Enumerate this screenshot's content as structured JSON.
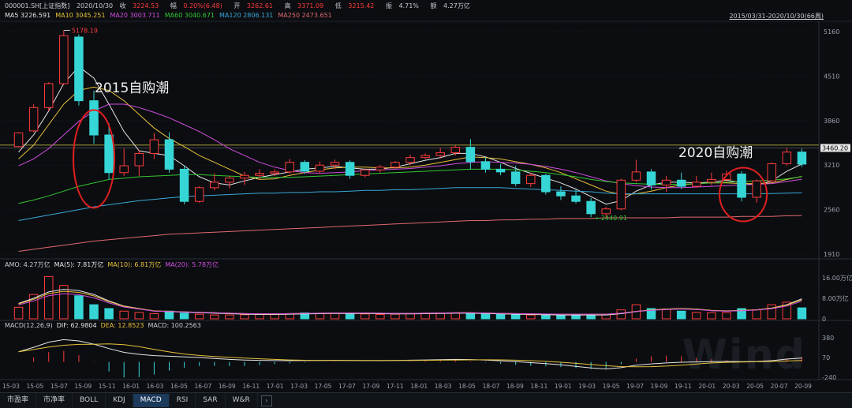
{
  "header": {
    "symbol": "000001.SH[上证指数]",
    "date": "2020/10/30",
    "close_label": "收",
    "close": "3224.53",
    "change_label": "幅",
    "change": "0.20%(6.48)",
    "open_label": "开",
    "open": "3262.61",
    "high_label": "高",
    "high": "3371.09",
    "low_label": "低",
    "low": "3215.42",
    "amplitude_label": "振",
    "amplitude": "4.71%",
    "volume_label": "额",
    "volume": "4.27万亿",
    "range": "2015/03/31-2020/10/30(66周)"
  },
  "colors": {
    "up": "#ff3b3b",
    "down": "#37d6d6",
    "ma5": "#e6e6e6",
    "ma10": "#e8c13a",
    "ma20": "#d24de0",
    "ma60": "#33c833",
    "ma120": "#3aa8d8",
    "ma250": "#e0696f",
    "annotation": "#e02020",
    "price_line": "#d7d24a"
  },
  "ma_bar": [
    {
      "label": "MA5",
      "value": "3226.591",
      "color": "#e6e6e6"
    },
    {
      "label": "MA10",
      "value": "3045.251",
      "color": "#e8c13a"
    },
    {
      "label": "MA20",
      "value": "3003.711",
      "color": "#d24de0"
    },
    {
      "label": "MA60",
      "value": "3040.671",
      "color": "#33c833"
    },
    {
      "label": "MA120",
      "value": "2806.131",
      "color": "#3aa8d8"
    },
    {
      "label": "MA250",
      "value": "2473.651",
      "color": "#e0696f"
    }
  ],
  "price_axis": [
    "5160",
    "4510",
    "3860",
    "3210",
    "2560",
    "1910"
  ],
  "price_markers": {
    "current": "3460.20",
    "upper": "3502.00"
  },
  "annotations": {
    "high_label": "5178.19",
    "low_label": "2440.91",
    "note_2015": "2015自购潮",
    "note_2020": "2020自购潮"
  },
  "amo_bar": [
    {
      "label": "AMO: 4.27万亿",
      "color": "#c8ccd2"
    },
    {
      "label": "MA(5): 7.81万亿",
      "color": "#e6e6e6"
    },
    {
      "label": "MA(10): 6.81万亿",
      "color": "#e8c13a"
    },
    {
      "label": "MA(20): 5.78万亿",
      "color": "#d24de0"
    }
  ],
  "amo_axis": [
    "16.00万亿",
    "8.00万亿",
    "0"
  ],
  "macd_bar": [
    {
      "label": "MACD(12,26,9)",
      "color": "#c8ccd2"
    },
    {
      "label": "DIF: 62.9804",
      "color": "#e6e6e6"
    },
    {
      "label": "DEA: 12.8523",
      "color": "#e8c13a"
    },
    {
      "label": "MACD: 100.2563",
      "color": "#c8ccd2"
    }
  ],
  "macd_axis": [
    "380",
    "70",
    "-240"
  ],
  "date_axis": [
    "15-03",
    "15-05",
    "15-07",
    "15-09",
    "15-11",
    "16-01",
    "16-03",
    "16-05",
    "16-07",
    "16-09",
    "16-11",
    "17-01",
    "17-03",
    "17-05",
    "17-07",
    "17-09",
    "17-11",
    "18-01",
    "18-03",
    "18-05",
    "18-07",
    "18-09",
    "18-11",
    "19-01",
    "19-03",
    "19-05",
    "19-07",
    "19-09",
    "19-11",
    "20-01",
    "20-03",
    "20-05",
    "20-07",
    "20-09"
  ],
  "tabs": [
    {
      "label": "市盈率",
      "active": false
    },
    {
      "label": "市净率",
      "active": false
    },
    {
      "label": "BOLL",
      "active": false
    },
    {
      "label": "KDJ",
      "active": false
    },
    {
      "label": "MACD",
      "active": true
    },
    {
      "label": "RSI",
      "active": false
    },
    {
      "label": "SAR",
      "active": false
    },
    {
      "label": "W&R",
      "active": false
    }
  ],
  "tab_arrow": "chevron-right-icon",
  "watermark": "Wind",
  "chart_data": {
    "type": "candlestick",
    "period": "weekly",
    "candles": [
      [
        3480,
        3690,
        3470,
        3680
      ],
      [
        3710,
        4100,
        3690,
        4050
      ],
      [
        4050,
        4420,
        4000,
        4400
      ],
      [
        4400,
        5178,
        4380,
        5100
      ],
      [
        5080,
        5120,
        4080,
        4150
      ],
      [
        4150,
        4300,
        3520,
        3650
      ],
      [
        3650,
        3820,
        3000,
        3100
      ],
      [
        3100,
        3450,
        3050,
        3200
      ],
      [
        3200,
        3430,
        3050,
        3380
      ],
      [
        3380,
        3680,
        3300,
        3580
      ],
      [
        3580,
        3690,
        3100,
        3150
      ],
      [
        3150,
        3200,
        2638,
        2680
      ],
      [
        2680,
        2900,
        2660,
        2880
      ],
      [
        2880,
        3090,
        2840,
        2960
      ],
      [
        2960,
        3050,
        2870,
        3020
      ],
      [
        3020,
        3110,
        2920,
        3060
      ],
      [
        3060,
        3150,
        3000,
        3090
      ],
      [
        3090,
        3150,
        3050,
        3110
      ],
      [
        3110,
        3300,
        3080,
        3250
      ],
      [
        3250,
        3280,
        3080,
        3120
      ],
      [
        3120,
        3260,
        3090,
        3210
      ],
      [
        3210,
        3290,
        3150,
        3250
      ],
      [
        3250,
        3280,
        3010,
        3060
      ],
      [
        3060,
        3150,
        3030,
        3140
      ],
      [
        3140,
        3210,
        3100,
        3180
      ],
      [
        3180,
        3270,
        3160,
        3250
      ],
      [
        3250,
        3360,
        3210,
        3320
      ],
      [
        3320,
        3380,
        3300,
        3350
      ],
      [
        3350,
        3460,
        3320,
        3390
      ],
      [
        3390,
        3500,
        3350,
        3470
      ],
      [
        3470,
        3590,
        3150,
        3260
      ],
      [
        3260,
        3320,
        3100,
        3150
      ],
      [
        3150,
        3230,
        3060,
        3110
      ],
      [
        3110,
        3200,
        2900,
        2940
      ],
      [
        2940,
        3100,
        2890,
        3060
      ],
      [
        3060,
        3080,
        2780,
        2820
      ],
      [
        2820,
        2900,
        2700,
        2760
      ],
      [
        2760,
        2850,
        2650,
        2680
      ],
      [
        2680,
        2730,
        2449,
        2500
      ],
      [
        2500,
        2600,
        2440,
        2570
      ],
      [
        2570,
        3010,
        2550,
        2990
      ],
      [
        2990,
        3288,
        2960,
        3110
      ],
      [
        3110,
        3150,
        2850,
        2920
      ],
      [
        2920,
        3050,
        2820,
        2990
      ],
      [
        2990,
        3100,
        2860,
        2900
      ],
      [
        2900,
        3050,
        2880,
        2960
      ],
      [
        2960,
        3100,
        2920,
        3000
      ],
      [
        3000,
        3130,
        2960,
        3080
      ],
      [
        3080,
        3120,
        2680,
        2740
      ],
      [
        2740,
        3000,
        2660,
        2980
      ],
      [
        2980,
        3250,
        2960,
        3230
      ],
      [
        3230,
        3460,
        3200,
        3400
      ],
      [
        3400,
        3450,
        3180,
        3224
      ]
    ],
    "ma_series": [
      {
        "name": "MA5",
        "values": [
          3400,
          3650,
          4000,
          4400,
          4650,
          4480,
          4100,
          3700,
          3420,
          3380,
          3350,
          3200,
          3040,
          2950,
          2920,
          2980,
          3030,
          3070,
          3110,
          3150,
          3170,
          3190,
          3170,
          3150,
          3150,
          3180,
          3230,
          3280,
          3320,
          3380,
          3380,
          3330,
          3250,
          3160,
          3090,
          3020,
          2950,
          2860,
          2750,
          2640,
          2690,
          2830,
          2920,
          2960,
          2960,
          2950,
          2960,
          2990,
          2950,
          2920,
          2980,
          3120,
          3226.59
        ]
      },
      {
        "name": "MA10",
        "values": [
          3300,
          3500,
          3800,
          4100,
          4300,
          4350,
          4300,
          4150,
          3950,
          3750,
          3600,
          3480,
          3350,
          3250,
          3150,
          3050,
          3000,
          3010,
          3060,
          3100,
          3140,
          3170,
          3180,
          3180,
          3170,
          3170,
          3180,
          3210,
          3250,
          3290,
          3330,
          3320,
          3300,
          3260,
          3220,
          3170,
          3100,
          3010,
          2920,
          2830,
          2780,
          2790,
          2830,
          2880,
          2920,
          2940,
          2950,
          2950,
          2940,
          2940,
          2950,
          3000,
          3045.25
        ]
      },
      {
        "name": "MA20",
        "values": [
          3200,
          3300,
          3450,
          3650,
          3850,
          4000,
          4100,
          4100,
          4050,
          3980,
          3900,
          3800,
          3700,
          3580,
          3450,
          3350,
          3250,
          3180,
          3130,
          3100,
          3090,
          3100,
          3110,
          3130,
          3140,
          3150,
          3160,
          3180,
          3200,
          3230,
          3250,
          3260,
          3250,
          3240,
          3220,
          3190,
          3150,
          3100,
          3040,
          2980,
          2940,
          2910,
          2890,
          2880,
          2880,
          2890,
          2900,
          2910,
          2920,
          2930,
          2940,
          2970,
          3003.71
        ]
      },
      {
        "name": "MA60",
        "values": [
          2650,
          2700,
          2760,
          2830,
          2900,
          2950,
          3000,
          3020,
          3040,
          3050,
          3060,
          3070,
          3070,
          3060,
          3050,
          3040,
          3030,
          3030,
          3030,
          3040,
          3050,
          3060,
          3070,
          3080,
          3090,
          3100,
          3110,
          3120,
          3130,
          3140,
          3150,
          3150,
          3150,
          3140,
          3120,
          3100,
          3070,
          3040,
          3000,
          2970,
          2950,
          2940,
          2930,
          2930,
          2930,
          2940,
          2950,
          2960,
          2970,
          2980,
          2990,
          3010,
          3040.67
        ]
      },
      {
        "name": "MA120",
        "values": [
          2400,
          2440,
          2480,
          2520,
          2560,
          2600,
          2630,
          2660,
          2690,
          2710,
          2730,
          2750,
          2760,
          2770,
          2780,
          2790,
          2800,
          2800,
          2810,
          2810,
          2820,
          2820,
          2830,
          2840,
          2840,
          2850,
          2850,
          2860,
          2870,
          2880,
          2880,
          2880,
          2880,
          2870,
          2860,
          2850,
          2840,
          2830,
          2820,
          2800,
          2790,
          2790,
          2790,
          2790,
          2790,
          2790,
          2790,
          2790,
          2790,
          2790,
          2795,
          2800,
          2806.13
        ]
      },
      {
        "name": "MA250",
        "values": [
          1950,
          1980,
          2010,
          2040,
          2070,
          2100,
          2120,
          2140,
          2160,
          2180,
          2200,
          2210,
          2220,
          2230,
          2240,
          2250,
          2260,
          2270,
          2280,
          2290,
          2300,
          2310,
          2320,
          2330,
          2340,
          2350,
          2360,
          2370,
          2380,
          2390,
          2400,
          2400,
          2410,
          2410,
          2420,
          2420,
          2430,
          2430,
          2430,
          2440,
          2440,
          2440,
          2440,
          2440,
          2450,
          2450,
          2450,
          2450,
          2460,
          2460,
          2460,
          2470,
          2473.65
        ]
      }
    ],
    "amo_values": [
      4.5,
      9.5,
      16.5,
      13.0,
      9.0,
      5.5,
      4.0,
      3.0,
      2.5,
      2.0,
      3.0,
      2.2,
      1.8,
      1.5,
      1.5,
      1.6,
      1.7,
      1.8,
      2.0,
      2.3,
      2.1,
      2.2,
      2.0,
      1.9,
      1.7,
      1.8,
      2.0,
      2.2,
      2.3,
      2.2,
      2.0,
      1.8,
      1.7,
      1.6,
      1.5,
      1.5,
      1.4,
      1.5,
      1.5,
      1.6,
      3.5,
      5.5,
      4.0,
      3.8,
      3.0,
      2.5,
      2.4,
      2.5,
      4.0,
      3.5,
      5.5,
      6.5,
      4.27
    ],
    "amo_ma5": [
      6.0,
      8.0,
      10.5,
      11.5,
      11.0,
      9.5,
      7.0,
      5.0,
      4.0,
      3.0,
      2.8,
      2.6,
      2.4,
      2.2,
      2.0,
      1.8,
      1.7,
      1.7,
      1.8,
      1.9,
      2.0,
      2.1,
      2.1,
      2.1,
      2.0,
      1.9,
      1.9,
      2.0,
      2.1,
      2.2,
      2.2,
      2.1,
      1.9,
      1.8,
      1.7,
      1.6,
      1.5,
      1.5,
      1.5,
      1.5,
      2.0,
      2.8,
      3.4,
      3.8,
      4.0,
      3.8,
      3.2,
      3.0,
      3.2,
      3.5,
      4.2,
      5.5,
      7.81
    ],
    "macd_dif": [
      160,
      230,
      310,
      350,
      330,
      280,
      210,
      150,
      120,
      100,
      90,
      80,
      70,
      55,
      40,
      30,
      25,
      22,
      20,
      22,
      24,
      26,
      24,
      22,
      22,
      24,
      28,
      32,
      36,
      40,
      38,
      30,
      18,
      5,
      -10,
      -25,
      -45,
      -70,
      -95,
      -110,
      -90,
      -50,
      -30,
      -15,
      -5,
      0,
      5,
      8,
      4,
      8,
      20,
      45,
      62.98
    ]
  }
}
